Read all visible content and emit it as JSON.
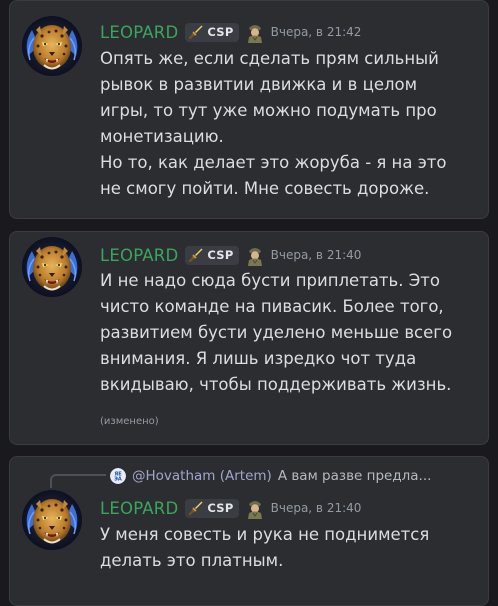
{
  "colors": {
    "background": "#1a1a1e",
    "card": "#2b2d31",
    "username": "#3ba55d",
    "text": "#dbdee1",
    "muted": "#949ba4",
    "mention": "#c9cdfb"
  },
  "messages": [
    {
      "author": "LEOPARD",
      "tag": "CSP",
      "tag_icon": "sword-icon",
      "badge_icon": "soldier-badge-icon",
      "timestamp": "Вчера, в 21:42",
      "paragraphs": [
        "Опять же, если сделать прям сильный рывок в развитии движка и в целом игры, то тут уже можно подумать про монетизацию.",
        "Но то, как делает это жоруба - я на это не смогу пойти. Мне совесть дороже."
      ]
    },
    {
      "author": "LEOPARD",
      "tag": "CSP",
      "tag_icon": "sword-icon",
      "badge_icon": "soldier-badge-icon",
      "timestamp": "Вчера, в 21:40",
      "paragraphs": [
        "И не надо сюда бусти приплетать. Это чисто команде на пивасик. Более того, развитием бусти уделено меньше всего внимания. Я лишь изредко чот туда вкидываю, чтобы поддерживать жизнь."
      ],
      "edited": "(изменено)"
    },
    {
      "reply": {
        "mention": "@Hovatham (Artem)",
        "preview": "А вам разве предла..."
      },
      "author": "LEOPARD",
      "tag": "CSP",
      "tag_icon": "sword-icon",
      "badge_icon": "soldier-badge-icon",
      "timestamp": "Вчера, в 21:40",
      "paragraphs": [
        "У меня совесть и рука не поднимется делать это платным."
      ]
    }
  ]
}
